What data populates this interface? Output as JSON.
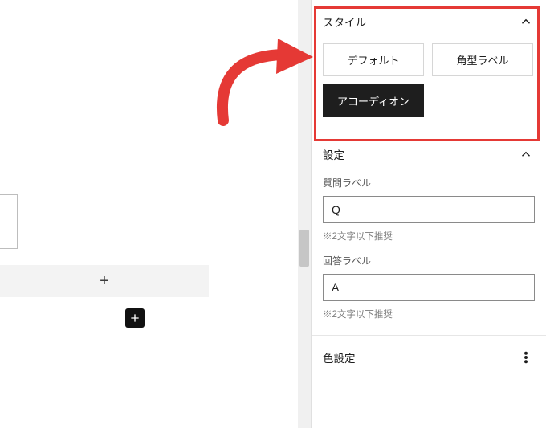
{
  "colors": {
    "highlight": "#e53935",
    "accent": "#e53935"
  },
  "canvas": {
    "plus_light": "+",
    "plus_dark_icon": "plus-icon"
  },
  "sidebar": {
    "style": {
      "title": "スタイル",
      "options": [
        {
          "label": "デフォルト",
          "selected": false
        },
        {
          "label": "角型ラベル",
          "selected": false
        },
        {
          "label": "アコーディオン",
          "selected": true
        }
      ]
    },
    "settings": {
      "title": "設定",
      "question_label": "質問ラベル",
      "question_value": "Q",
      "question_hint": "※2文字以下推奨",
      "answer_label": "回答ラベル",
      "answer_value": "A",
      "answer_hint": "※2文字以下推奨"
    },
    "color_settings": {
      "title": "色設定"
    }
  }
}
